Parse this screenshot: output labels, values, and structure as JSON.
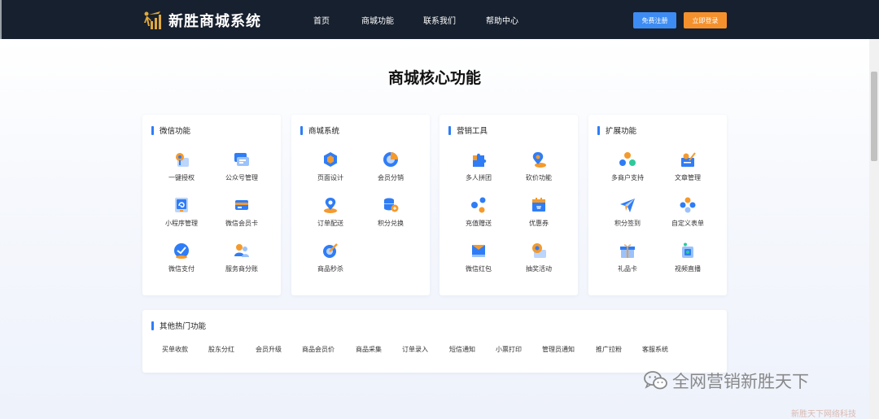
{
  "app": {
    "logo_text": "新胜商城系统"
  },
  "nav": {
    "items": [
      "首页",
      "商城功能",
      "联系我们",
      "帮助中心"
    ],
    "register_label": "免费注册",
    "login_label": "立即登录"
  },
  "main": {
    "title": "商城核心功能"
  },
  "cards": [
    {
      "title": "微信功能",
      "items": [
        {
          "label": "一键授权",
          "icon": "wechat-auth-icon"
        },
        {
          "label": "公众号管理",
          "icon": "official-account-icon"
        },
        {
          "label": "小程序管理",
          "icon": "mini-program-icon"
        },
        {
          "label": "微信会员卡",
          "icon": "member-card-icon"
        },
        {
          "label": "微信支付",
          "icon": "wechat-pay-icon"
        },
        {
          "label": "服务商分账",
          "icon": "split-account-icon"
        }
      ]
    },
    {
      "title": "商城系统",
      "items": [
        {
          "label": "页面设计",
          "icon": "page-design-icon"
        },
        {
          "label": "会员分销",
          "icon": "distribution-icon"
        },
        {
          "label": "订单配送",
          "icon": "delivery-icon"
        },
        {
          "label": "积分兑换",
          "icon": "points-exchange-icon"
        },
        {
          "label": "商品秒杀",
          "icon": "flash-sale-icon"
        }
      ]
    },
    {
      "title": "营销工具",
      "items": [
        {
          "label": "多人拼团",
          "icon": "group-buy-icon"
        },
        {
          "label": "砍价功能",
          "icon": "bargain-icon"
        },
        {
          "label": "充值赠送",
          "icon": "recharge-icon"
        },
        {
          "label": "优惠券",
          "icon": "coupon-icon"
        },
        {
          "label": "微信红包",
          "icon": "red-packet-icon"
        },
        {
          "label": "抽奖活动",
          "icon": "lottery-icon"
        }
      ]
    },
    {
      "title": "扩展功能",
      "items": [
        {
          "label": "多商户支持",
          "icon": "multi-merchant-icon"
        },
        {
          "label": "文章管理",
          "icon": "article-icon"
        },
        {
          "label": "积分签到",
          "icon": "check-in-icon"
        },
        {
          "label": "自定义表单",
          "icon": "custom-form-icon"
        },
        {
          "label": "礼品卡",
          "icon": "gift-card-icon"
        },
        {
          "label": "视频直播",
          "icon": "live-video-icon"
        }
      ]
    }
  ],
  "hot": {
    "title": "其他热门功能",
    "items": [
      "买单收款",
      "股东分红",
      "会员升级",
      "商品会员价",
      "商品采集",
      "订单录入",
      "短信通知",
      "小票打印",
      "管理员通知",
      "推广拉粉",
      "客服系统"
    ]
  },
  "watermark": {
    "text": "全网营销新胜天下",
    "sub_text": "新胜天下网络科技"
  },
  "colors": {
    "topbar": "#17202e",
    "accent_blue": "#2f7df6",
    "register": "#3d8cf3",
    "login": "#f5912d"
  }
}
